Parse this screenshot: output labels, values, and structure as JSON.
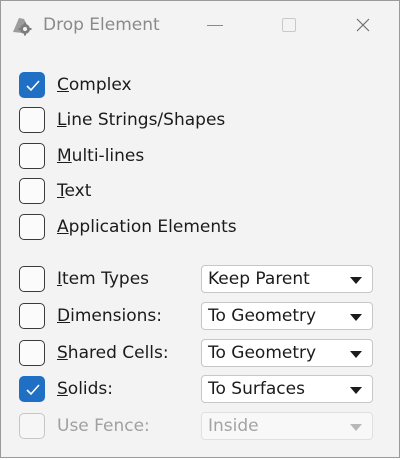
{
  "window": {
    "title": "Drop Element",
    "icon": "drop-element-app-icon",
    "controls": {
      "minimize": "minimize-icon",
      "maximize": "maximize-icon",
      "close": "close-icon"
    }
  },
  "accent_color": "#1f6fc4",
  "options": [
    {
      "key": "Complex",
      "ul": "C",
      "rest": "omplex",
      "checked": true
    },
    {
      "key": "Line Strings/Shapes",
      "ul": "L",
      "rest": "ine Strings/Shapes",
      "checked": false
    },
    {
      "key": "Multi-lines",
      "ul": "M",
      "rest": "ulti-lines",
      "checked": false
    },
    {
      "key": "Text",
      "ul": "T",
      "rest": "ext",
      "checked": false
    },
    {
      "key": "Application Elements",
      "ul": "A",
      "rest": "pplication Elements",
      "checked": false
    }
  ],
  "dropdown_options": [
    {
      "key": "Item Types",
      "ul": "I",
      "rest": "tem Types",
      "checked": false,
      "value": "Keep Parent",
      "enabled": true
    },
    {
      "key": "Dimensions:",
      "ul": "D",
      "rest": "imensions:",
      "checked": false,
      "value": "To Geometry",
      "enabled": true
    },
    {
      "key": "Shared Cells:",
      "ul": "S",
      "rest": "hared Cells:",
      "checked": false,
      "value": "To Geometry",
      "enabled": true
    },
    {
      "key": "Solids:",
      "ul": "S",
      "rest": "olids:",
      "checked": true,
      "value": "To Surfaces",
      "enabled": true
    },
    {
      "key": "Use Fence:",
      "ul": "",
      "rest": "Use Fence:",
      "checked": false,
      "value": "Inside",
      "enabled": false
    }
  ]
}
